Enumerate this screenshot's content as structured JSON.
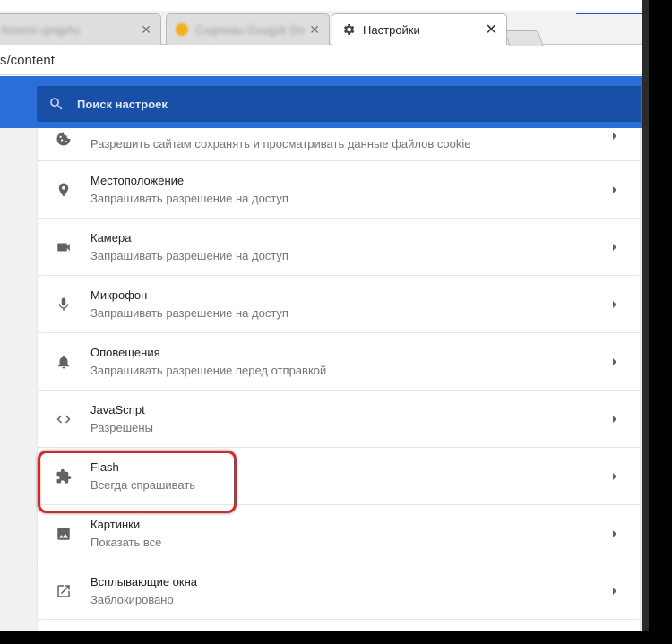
{
  "browser": {
    "tabs": [
      {
        "label": "Amsmi ujnqphc",
        "active": false
      },
      {
        "label": "Cxqnwau Gxugzk Dmrr",
        "active": false
      },
      {
        "label": "Настройки",
        "active": true
      }
    ],
    "url": "s/content"
  },
  "search": {
    "placeholder": "Поиск настроек"
  },
  "settings": {
    "rows": [
      {
        "title": "",
        "subtitle": "Разрешить сайтам сохранять и просматривать данные файлов cookie",
        "icon": "cookie-icon"
      },
      {
        "title": "Местоположение",
        "subtitle": "Запрашивать разрешение на доступ",
        "icon": "location-icon"
      },
      {
        "title": "Камера",
        "subtitle": "Запрашивать разрешение на доступ",
        "icon": "camera-icon"
      },
      {
        "title": "Микрофон",
        "subtitle": "Запрашивать разрешение на доступ",
        "icon": "microphone-icon"
      },
      {
        "title": "Оповещения",
        "subtitle": "Запрашивать разрешение перед отправкой",
        "icon": "bell-icon"
      },
      {
        "title": "JavaScript",
        "subtitle": "Разрешены",
        "icon": "code-icon"
      },
      {
        "title": "Flash",
        "subtitle": "Всегда спрашивать",
        "icon": "puzzle-icon"
      },
      {
        "title": "Картинки",
        "subtitle": "Показать все",
        "icon": "image-icon"
      },
      {
        "title": "Всплывающие окна",
        "subtitle": "Заблокировано",
        "icon": "popup-icon"
      }
    ]
  },
  "colors": {
    "header": "#2a6fd8",
    "search": "#1a4fa8",
    "highlight": "#d12a2a"
  }
}
